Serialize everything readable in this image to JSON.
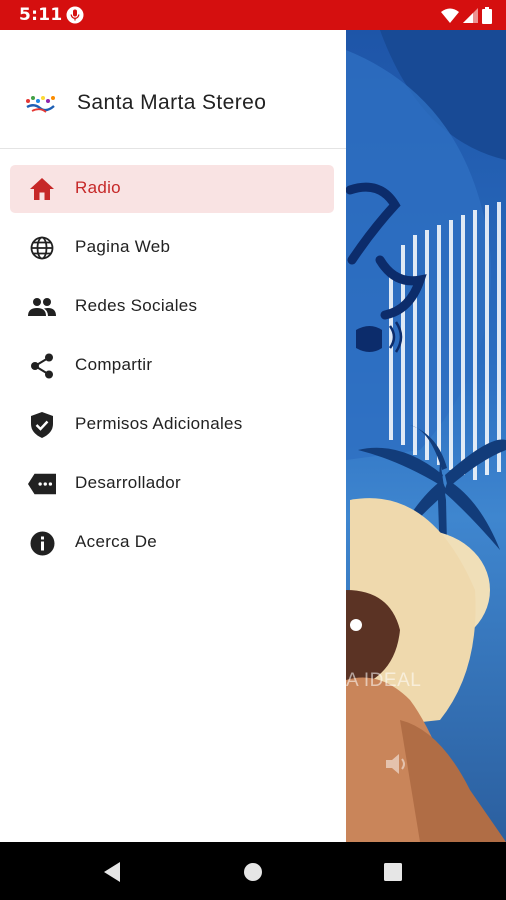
{
  "status": {
    "time": "5:11"
  },
  "drawer": {
    "app_name": "Santa Marta Stereo",
    "menu": [
      {
        "label": "Radio",
        "icon": "home-icon",
        "active": true
      },
      {
        "label": "Pagina Web",
        "icon": "globe-icon"
      },
      {
        "label": "Redes Sociales",
        "icon": "people-icon"
      },
      {
        "label": "Compartir",
        "icon": "share-icon"
      },
      {
        "label": "Permisos Adicionales",
        "icon": "shield-check-icon"
      },
      {
        "label": "Desarrollador",
        "icon": "tag-label-icon"
      },
      {
        "label": "Acerca De",
        "icon": "info-icon"
      }
    ]
  },
  "background": {
    "tagline": "A IDEAL"
  },
  "colors": {
    "status_bar": "#d50f0f",
    "accent": "#c62828",
    "active_bg": "#f9e3e3"
  }
}
